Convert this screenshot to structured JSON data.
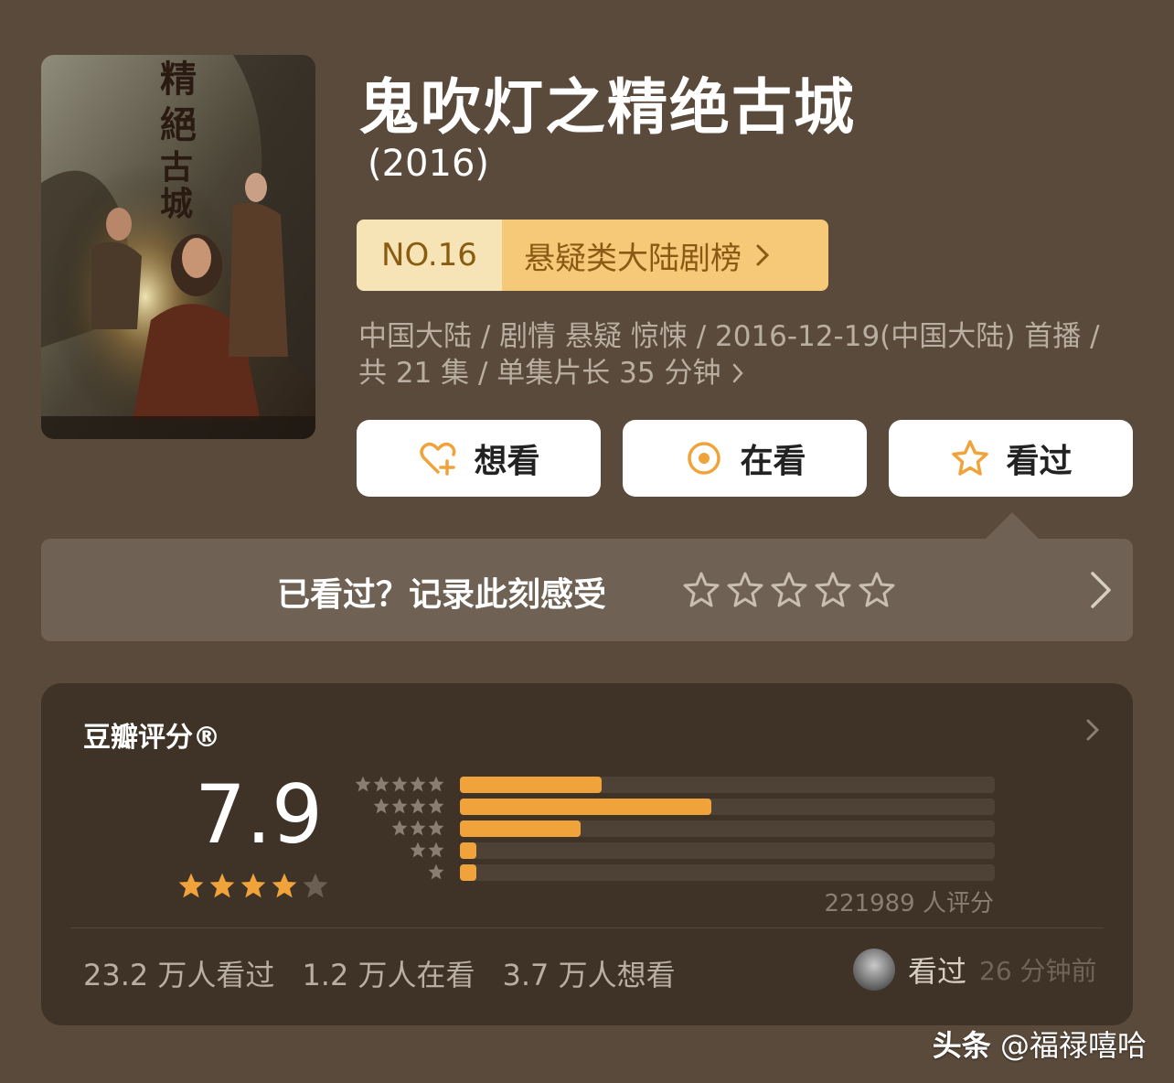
{
  "show": {
    "title": "鬼吹灯之精绝古城",
    "year": "(2016)",
    "poster_alt_text": "精绝古城"
  },
  "rank": {
    "number": "NO.16",
    "list_name": "悬疑类大陆剧榜"
  },
  "meta": {
    "line1": "中国大陆 / 剧情 悬疑 惊悚 / 2016-12-19(中国大陆) 首播 /",
    "line2": "共 21 集 / 单集片长 35 分钟"
  },
  "actions": {
    "want": "想看",
    "watching": "在看",
    "watched": "看过"
  },
  "record": {
    "prompt": "已看过？记录此刻感受",
    "star_count": 5
  },
  "rating": {
    "label": "豆瓣评分®",
    "score": "7.9",
    "stars": 4,
    "distribution": [
      {
        "stars": 5,
        "fraction": 0.265
      },
      {
        "stars": 4,
        "fraction": 0.47
      },
      {
        "stars": 3,
        "fraction": 0.225
      },
      {
        "stars": 2,
        "fraction": 0.03
      },
      {
        "stars": 1,
        "fraction": 0.03
      }
    ],
    "count_text": "221989 人评分"
  },
  "stats": {
    "watched": "23.2 万人看过",
    "watching": "1.2 万人在看",
    "want": "3.7 万人想看"
  },
  "recent": {
    "action": "看过",
    "time": "26 分钟前"
  },
  "watermark": {
    "brand": "头条",
    "account": "@福禄嘻哈"
  },
  "colors": {
    "background": "#5a4a3b",
    "accent": "#f0a33a",
    "rank_light": "#f7e4b6",
    "rank_gold": "#f5c978"
  }
}
